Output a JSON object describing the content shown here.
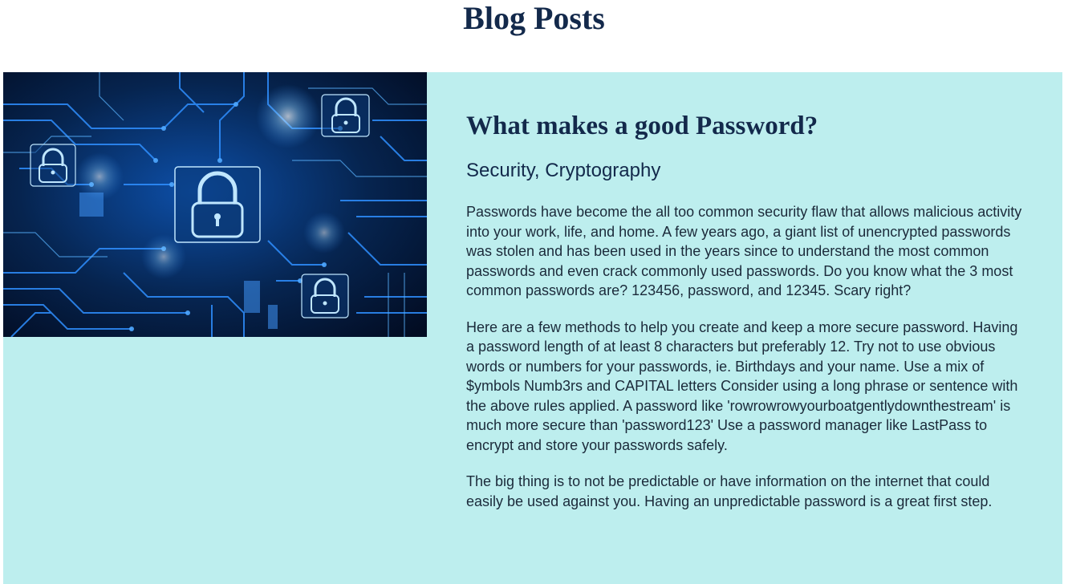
{
  "header": {
    "title": "Blog Posts"
  },
  "post": {
    "image_alt": "Circuit board with padlock icons",
    "title": "What makes a good Password?",
    "categories": "Security, Cryptography",
    "paragraphs": [
      "Passwords have become the all too common security flaw that allows malicious activity into your work, life, and home. A few years ago, a giant list of unencrypted passwords was stolen and has been used in the years since to understand the most common passwords and even crack commonly used passwords. Do you know what the 3 most common passwords are? 123456, password, and 12345. Scary right?",
      "Here are a few methods to help you create and keep a more secure password. Having a password length of at least 8 characters but preferably 12. Try not to use obvious words or numbers for your passwords, ie. Birthdays and your name. Use a mix of $ymbols Numb3rs and CAPITAL letters Consider using a long phrase or sentence with the above rules applied. A password like 'rowrowrowyourboatgentlydownthestream' is much more secure than 'password123' Use a password manager like LastPass to encrypt and store your passwords safely.",
      "The big thing is to not be predictable or have information on the internet that could easily be used against you. Having an unpredictable password is a great first step."
    ]
  },
  "colors": {
    "card_background": "#bdeeee",
    "title_color": "#13294b",
    "image_base": "#041a3d",
    "circuit_glow": "#2f8fff"
  },
  "icons": {
    "image_motif": "padlock-icon"
  }
}
